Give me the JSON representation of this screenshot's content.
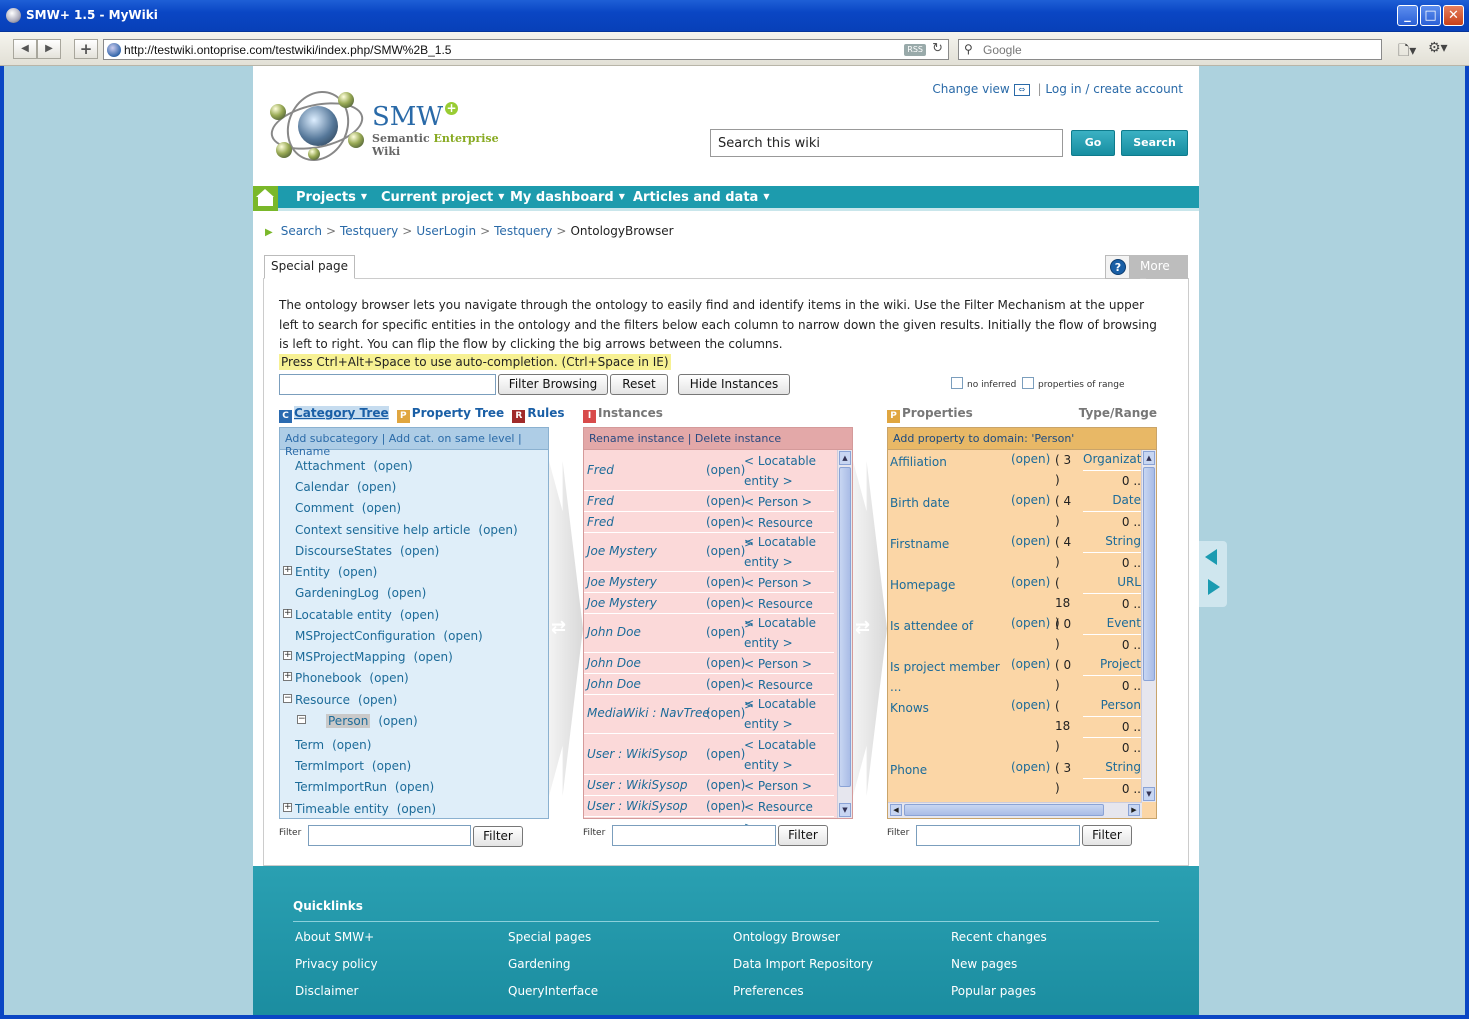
{
  "window": {
    "title": "SMW+ 1.5 - MyWiki"
  },
  "browser": {
    "url": "http://testwiki.ontoprise.com/testwiki/index.php/SMW%2B_1.5",
    "rss": "RSS",
    "search_placeholder": "Google"
  },
  "logo": {
    "name": "SMW",
    "tagline_a": "Semantic ",
    "tagline_b": "Enterprise",
    "tagline_c": " Wiki"
  },
  "header": {
    "change_view": "Change view",
    "login": "Log in / create account",
    "search_value": "Search this wiki",
    "go": "Go",
    "search": "Search"
  },
  "nav": [
    "Projects",
    "Current project",
    "My dashboard",
    "Articles and data"
  ],
  "breadcrumb": [
    "Search",
    "Testquery",
    "UserLogin",
    "Testquery",
    "OntologyBrowser"
  ],
  "tabs": {
    "special": "Special page",
    "more": "More"
  },
  "intro": "The ontology browser lets you navigate through the ontology to easily find and identify items in the wiki. Use the Filter Mechanism at the upper left to search for specific entities in the ontology and the filters below each column to narrow down the given results. Initially the flow of browsing is left to right. You can flip the flow by clicking the big arrows between the columns.",
  "hint": "Press Ctrl+Alt+Space to use auto-completion. (Ctrl+Space in IE)",
  "controls": {
    "filter_browsing": "Filter Browsing",
    "reset": "Reset",
    "hide_instances": "Hide Instances",
    "no_inferred": "no inferred",
    "properties_of_range": "properties of range"
  },
  "columns": {
    "category": {
      "tab1": "Category Tree",
      "tab2": "Property Tree",
      "tab3": "Rules",
      "actions": "Add subcategory | Add cat. on same level | Rename",
      "items": [
        {
          "label": "Attachment",
          "open": "(open)",
          "expand": ""
        },
        {
          "label": "Calendar",
          "open": "(open)",
          "expand": ""
        },
        {
          "label": "Comment",
          "open": "(open)",
          "expand": ""
        },
        {
          "label": "Context sensitive help article",
          "open": "(open)",
          "expand": ""
        },
        {
          "label": "DiscourseStates",
          "open": "(open)",
          "expand": ""
        },
        {
          "label": "Entity",
          "open": "(open)",
          "expand": "+"
        },
        {
          "label": "GardeningLog",
          "open": "(open)",
          "expand": ""
        },
        {
          "label": "Locatable entity",
          "open": "(open)",
          "expand": "+"
        },
        {
          "label": "MSProjectConfiguration",
          "open": "(open)",
          "expand": ""
        },
        {
          "label": "MSProjectMapping",
          "open": "(open)",
          "expand": "+"
        },
        {
          "label": "Phonebook",
          "open": "(open)",
          "expand": "+"
        },
        {
          "label": "Resource",
          "open": "(open)",
          "expand": "−"
        },
        {
          "label": "Person",
          "open": "(open)",
          "expand": "−"
        },
        {
          "label": "Term",
          "open": "(open)",
          "expand": ""
        },
        {
          "label": "TermImport",
          "open": "(open)",
          "expand": ""
        },
        {
          "label": "TermImportRun",
          "open": "(open)",
          "expand": ""
        },
        {
          "label": "Timeable entity",
          "open": "(open)",
          "expand": "+"
        }
      ]
    },
    "instances": {
      "title": "Instances",
      "actions": "Rename instance | Delete instance",
      "items": [
        {
          "name": "Fred",
          "open": "(open)",
          "type": "< Locatable entity >"
        },
        {
          "name": "Fred",
          "open": "(open)",
          "type": "< Person >"
        },
        {
          "name": "Fred",
          "open": "(open)",
          "type": "< Resource >"
        },
        {
          "name": "Joe Mystery",
          "open": "(open)",
          "type": "< Locatable entity >"
        },
        {
          "name": "Joe Mystery",
          "open": "(open)",
          "type": "< Person >"
        },
        {
          "name": "Joe Mystery",
          "open": "(open)",
          "type": "< Resource >"
        },
        {
          "name": "John Doe",
          "open": "(open)",
          "type": "< Locatable entity >"
        },
        {
          "name": "John Doe",
          "open": "(open)",
          "type": "< Person >"
        },
        {
          "name": "John Doe",
          "open": "(open)",
          "type": "< Resource >"
        },
        {
          "name": "MediaWiki : NavTree",
          "open": "(open)",
          "type": "< Locatable entity >"
        },
        {
          "name": "User : WikiSysop",
          "open": "(open)",
          "type": "< Locatable entity >"
        },
        {
          "name": "User : WikiSysop",
          "open": "(open)",
          "type": "< Person >"
        },
        {
          "name": "User : WikiSysop",
          "open": "(open)",
          "type": "< Resource >"
        }
      ]
    },
    "properties": {
      "title": "Properties",
      "type_range": "Type/Range",
      "actions": "Add property to domain: 'Person'",
      "items": [
        {
          "name": "Affiliation",
          "open": "(open)",
          "count": "( 3 )",
          "type": "Organization",
          "z1": "0 ..",
          "z2": ""
        },
        {
          "name": "Birth date",
          "open": "(open)",
          "count": "( 4 )",
          "type": "Date",
          "z1": "0 ..",
          "z2": ""
        },
        {
          "name": "Firstname",
          "open": "(open)",
          "count": "( 4 )",
          "type": "String",
          "z1": "0 ..",
          "z2": ""
        },
        {
          "name": "Homepage",
          "open": "(open)",
          "count": "( 18 )",
          "type": "URL",
          "z1": "0 ..",
          "z2": ""
        },
        {
          "name": "Is attendee of",
          "open": "(open)",
          "count": "( 0 )",
          "type": "Event",
          "z1": "0 ..",
          "z2": ""
        },
        {
          "name": "Is project member ...",
          "open": "(open)",
          "count": "( 0 )",
          "type": "Project",
          "z1": "0 ..",
          "z2": ""
        },
        {
          "name": "Knows",
          "open": "(open)",
          "count": "( 18 )",
          "type": "Person",
          "z1": "0 ..",
          "z2": "0 .."
        },
        {
          "name": "Phone",
          "open": "(open)",
          "count": "( 3 )",
          "type": "String",
          "z1": "0 ..",
          "z2": ""
        }
      ]
    }
  },
  "filter": {
    "label": "Filter",
    "button": "Filter"
  },
  "footer": {
    "title": "Quicklinks",
    "links": [
      [
        "About SMW+",
        "Privacy policy",
        "Disclaimer"
      ],
      [
        "Special pages",
        "Gardening",
        "QueryInterface"
      ],
      [
        "Ontology Browser",
        "Data Import Repository",
        "Preferences"
      ],
      [
        "Recent changes",
        "New pages",
        "Popular pages"
      ]
    ]
  }
}
